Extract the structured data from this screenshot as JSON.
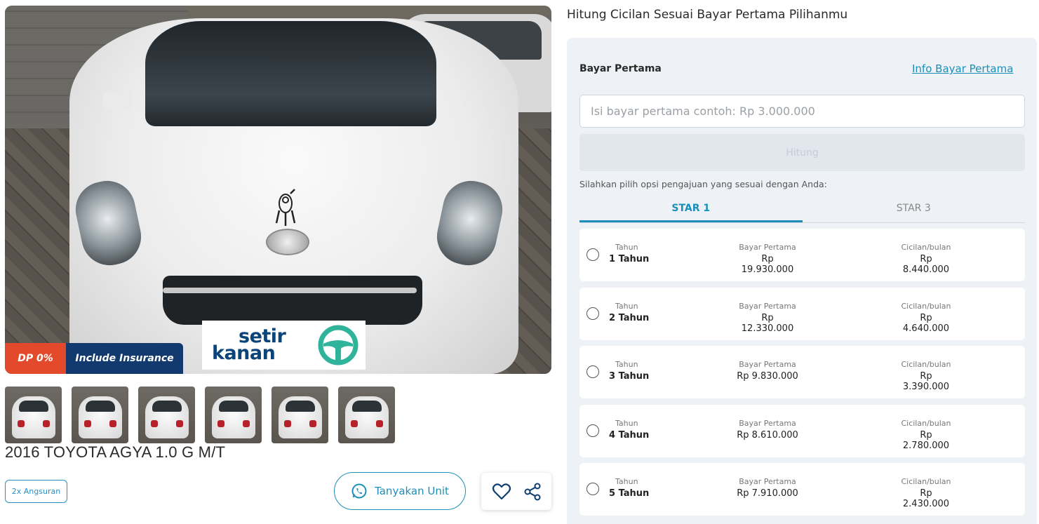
{
  "gallery": {
    "badge_dp": "DP 0%",
    "badge_insurance": "Include Insurance",
    "watermark_text": [
      "setir",
      "kanan"
    ],
    "bg_sticker_text": [
      "setir",
      "kanan"
    ],
    "thumbnail_count": 6
  },
  "car": {
    "title": "2016 TOYOTA AGYA 1.0 G M/T",
    "chip": "2x Angsuran",
    "ask_button": "Tanyakan Unit"
  },
  "calculator": {
    "heading": "Hitung Cicilan Sesuai Bayar Pertama Pilihanmu",
    "field_label": "Bayar Pertama",
    "info_link": "Info Bayar Pertama",
    "input_value": "",
    "input_placeholder": "Isi bayar pertama contoh: Rp 3.000.000",
    "submit_label": "Hitung",
    "hint": "Silahkan pilih opsi pengajuan yang sesuai dengan Anda:",
    "tabs": [
      {
        "label": "STAR 1",
        "active": true
      },
      {
        "label": "STAR 3",
        "active": false
      }
    ],
    "col_tenor": "Tahun",
    "col_dp": "Bayar Pertama",
    "col_monthly": "Cicilan/bulan",
    "options": [
      {
        "tenor": "1 Tahun",
        "dp": "Rp 19.930.000",
        "monthly": "Rp 8.440.000"
      },
      {
        "tenor": "2 Tahun",
        "dp": "Rp 12.330.000",
        "monthly": "Rp 4.640.000"
      },
      {
        "tenor": "3 Tahun",
        "dp": "Rp 9.830.000",
        "monthly": "Rp 3.390.000"
      },
      {
        "tenor": "4 Tahun",
        "dp": "Rp 8.610.000",
        "monthly": "Rp 2.780.000"
      },
      {
        "tenor": "5 Tahun",
        "dp": "Rp 7.910.000",
        "monthly": "Rp 2.430.000"
      }
    ]
  },
  "colors": {
    "accent": "#1b8fb8",
    "badge_dp": "#e34a2b",
    "badge_insurance": "#123a6e",
    "panel_bg": "#eef2f6"
  },
  "icons": [
    "whatsapp-icon",
    "heart-icon",
    "share-icon",
    "radio-icon",
    "steering-wheel-logo-icon"
  ]
}
